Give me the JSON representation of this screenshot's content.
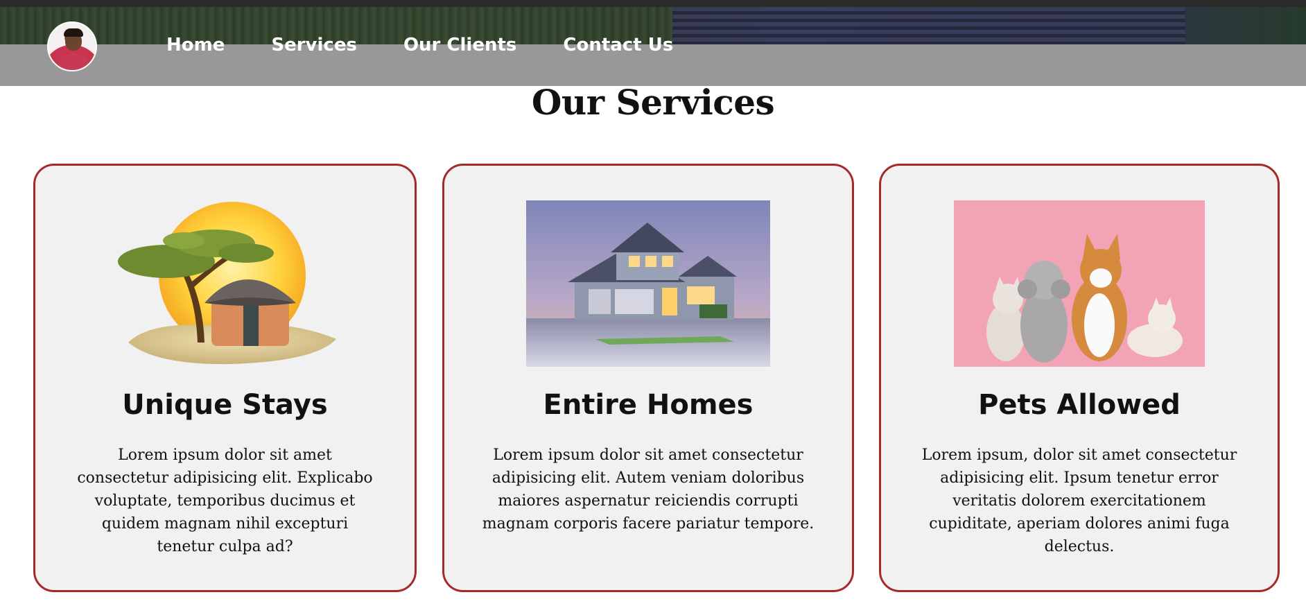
{
  "nav": {
    "links": [
      "Home",
      "Services",
      "Our Clients",
      "Contact Us"
    ]
  },
  "page": {
    "title": "Our Services"
  },
  "services": [
    {
      "title": "Unique Stays",
      "text": "Lorem ipsum dolor sit amet consectetur adipisicing elit. Explicabo voluptate, temporibus ducimus et quidem magnam nihil excepturi tenetur culpa ad?",
      "image": "hut-tree-sun-illustration"
    },
    {
      "title": "Entire Homes",
      "text": "Lorem ipsum dolor sit amet consectetur adipisicing elit. Autem veniam doloribus maiores aspernatur reiciendis corrupti magnam corporis facere pariatur tempore.",
      "image": "house-photo"
    },
    {
      "title": "Pets Allowed",
      "text": "Lorem ipsum, dolor sit amet consectetur adipisicing elit. Ipsum tenetur error veritatis dolorem exercitationem cupiditate, aperiam dolores animi fuga delectus.",
      "image": "cats-and-dogs-photo"
    }
  ],
  "colors": {
    "nav_bg": "#989898",
    "card_bg": "#f1f1f1",
    "card_border": "#a52a2a",
    "text": "#111111"
  }
}
